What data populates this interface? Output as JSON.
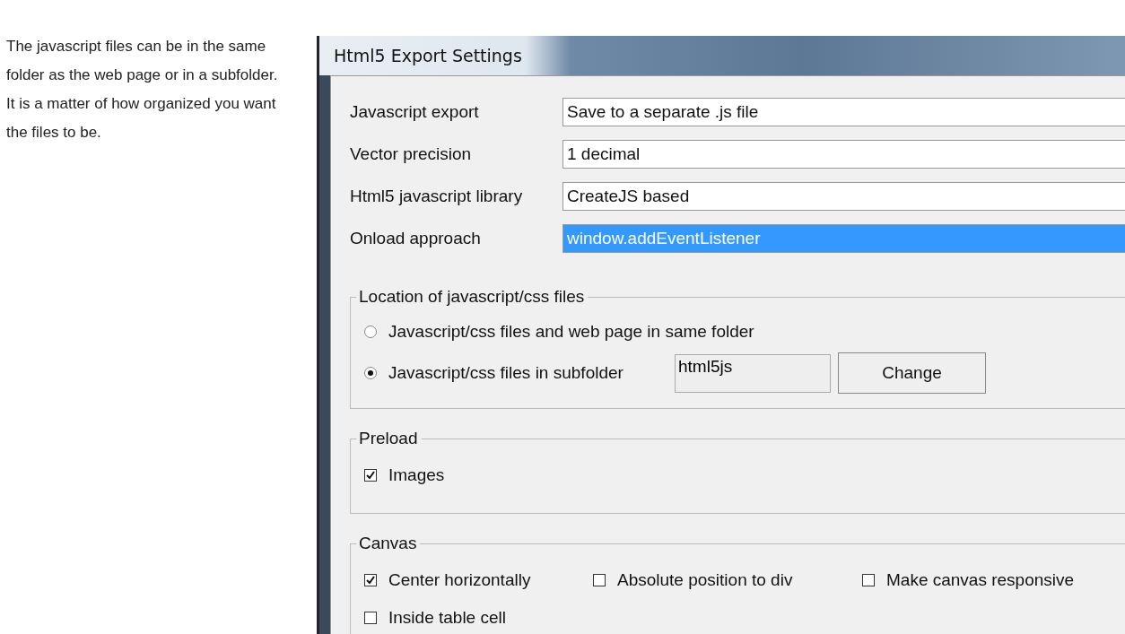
{
  "intro": "The javascript files can be in the same folder as the web page or in a subfolder. It is a matter of how organized you want the files to be.",
  "window": {
    "title": "Html5 Export Settings"
  },
  "settings": [
    {
      "label": "Javascript export",
      "value": "Save to a separate .js file",
      "selected": false
    },
    {
      "label": "Vector precision",
      "value": "1 decimal",
      "selected": false
    },
    {
      "label": "Html5 javascript library",
      "value": "CreateJS based",
      "selected": false
    },
    {
      "label": "Onload approach",
      "value": "window.addEventListener",
      "selected": true
    }
  ],
  "location": {
    "title": "Location of javascript/css files",
    "options": [
      {
        "label": "Javascript/css files and web page in same folder",
        "selected": false
      },
      {
        "label": "Javascript/css files in subfolder",
        "selected": true
      }
    ],
    "folder": "html5js",
    "button": "Change"
  },
  "preload": {
    "title": "Preload",
    "options": [
      {
        "label": "Images",
        "checked": true
      }
    ]
  },
  "canvas": {
    "title": "Canvas",
    "options": [
      {
        "label": "Center horizontally",
        "checked": true
      },
      {
        "label": "Absolute position to div",
        "checked": false
      },
      {
        "label": "Make canvas responsive",
        "checked": false
      },
      {
        "label": "Inside table cell",
        "checked": false
      }
    ]
  }
}
